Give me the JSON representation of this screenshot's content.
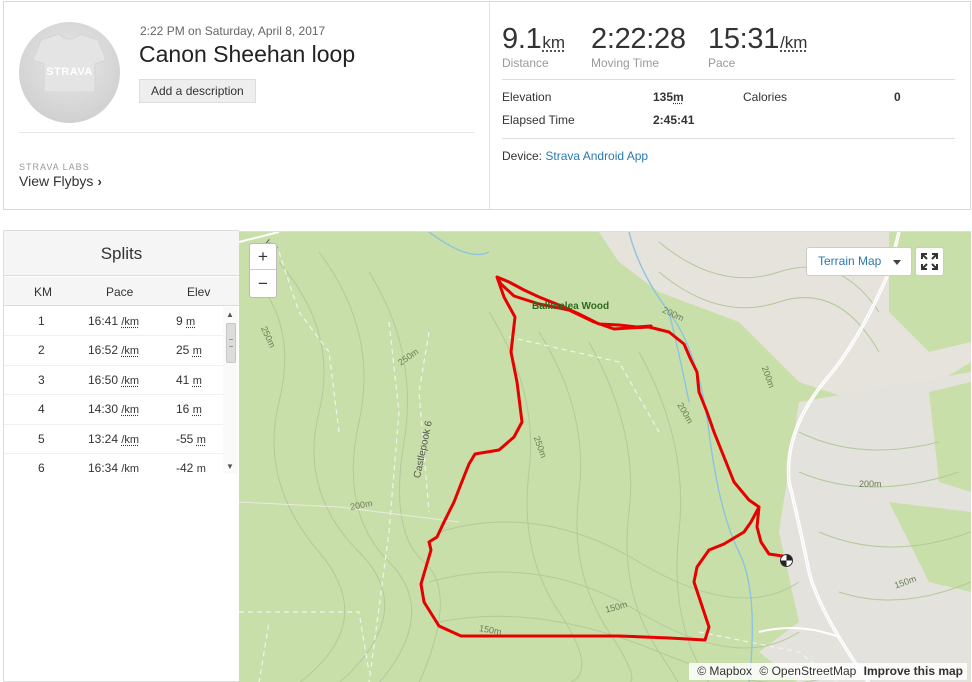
{
  "activity": {
    "datetime": "2:22 PM on Saturday, April 8, 2017",
    "title": "Canon Sheehan loop",
    "add_description_label": "Add a description",
    "avatar_logo": "STRAVA"
  },
  "labs": {
    "label": "STRAVA LABS",
    "link_label": "View Flybys"
  },
  "stats": {
    "distance": {
      "value": "9.1",
      "unit": "km",
      "label": "Distance"
    },
    "moving_time": {
      "value": "2:22:28",
      "label": "Moving Time"
    },
    "pace": {
      "value": "15:31",
      "unit": "/km",
      "label": "Pace"
    }
  },
  "more_stats": {
    "elevation_label": "Elevation",
    "elevation_value": "135",
    "elevation_unit": "m",
    "calories_label": "Calories",
    "calories_value": "0",
    "elapsed_label": "Elapsed Time",
    "elapsed_value": "2:45:41"
  },
  "device": {
    "label": "Device:",
    "name": "Strava Android App"
  },
  "splits": {
    "title": "Splits",
    "headers": {
      "km": "KM",
      "pace": "Pace",
      "elev": "Elev"
    },
    "rows": [
      {
        "km": "1",
        "pace": "16:41",
        "pace_unit": "/km",
        "elev": "9",
        "elev_unit": "m"
      },
      {
        "km": "2",
        "pace": "16:52",
        "pace_unit": "/km",
        "elev": "25",
        "elev_unit": "m"
      },
      {
        "km": "3",
        "pace": "16:50",
        "pace_unit": "/km",
        "elev": "41",
        "elev_unit": "m"
      },
      {
        "km": "4",
        "pace": "14:30",
        "pace_unit": "/km",
        "elev": "16",
        "elev_unit": "m"
      },
      {
        "km": "5",
        "pace": "13:24",
        "pace_unit": "/km",
        "elev": "-55",
        "elev_unit": "m"
      },
      {
        "km": "6",
        "pace": "16:34",
        "pace_unit": "/km",
        "elev": "-42",
        "elev_unit": "m"
      }
    ]
  },
  "map": {
    "zoom_in": "+",
    "zoom_out": "−",
    "style_selector": "Terrain Map",
    "attribution_mapbox": "© Mapbox",
    "attribution_osm": "© OpenStreetMap",
    "improve_link": "Improve this map",
    "labels": {
      "wood": "Ballinelea Wood",
      "road": "Castlepook 6",
      "road_top": "k 8",
      "c200a": "200m",
      "c200b": "200m",
      "c200c": "200m",
      "c200d": "200m",
      "c200e": "200m",
      "c250a": "250m",
      "c250b": "250m",
      "c250c": "250m",
      "c150a": "150m",
      "c150b": "150m",
      "c150c": "150m"
    },
    "colors": {
      "route": "#e60000",
      "land": "#c9dfa9",
      "water": "#8ec3e0",
      "road": "#ffffff"
    }
  }
}
